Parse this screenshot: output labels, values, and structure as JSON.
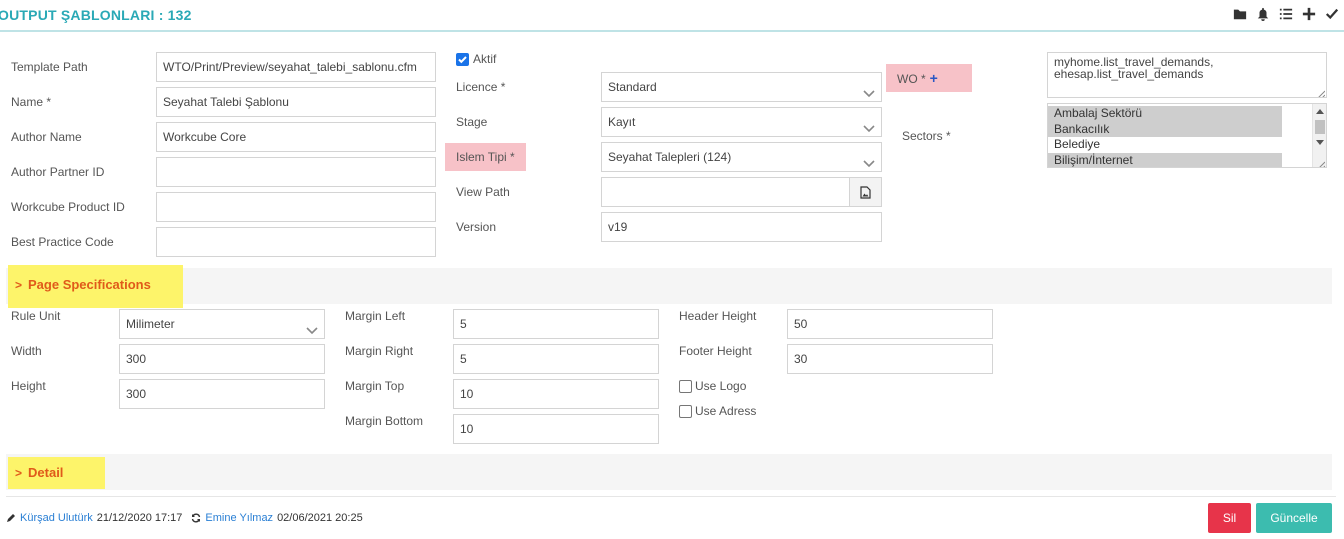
{
  "header": {
    "title": "OUTPUT ŞABLONLARI : 132",
    "icons": [
      "folder-icon",
      "bell-icon",
      "list-icon",
      "plus-icon",
      "check-icon"
    ]
  },
  "form": {
    "template_path": {
      "label": "Template Path",
      "value": "WTO/Print/Preview/seyahat_talebi_sablonu.cfm"
    },
    "name": {
      "label": "Name *",
      "value": "Seyahat Talebi Şablonu"
    },
    "author_name": {
      "label": "Author Name",
      "value": "Workcube Core"
    },
    "author_partner_id": {
      "label": "Author Partner ID",
      "value": ""
    },
    "workcube_product_id": {
      "label": "Workcube Product ID",
      "value": ""
    },
    "best_practice_code": {
      "label": "Best Practice Code",
      "value": ""
    },
    "aktif": {
      "label": "Aktif",
      "checked": true
    },
    "licence": {
      "label": "Licence *",
      "value": "Standard"
    },
    "stage": {
      "label": "Stage",
      "value": "Kayıt"
    },
    "islem_tipi": {
      "label": "Islem Tipi *",
      "value": "Seyahat Talepleri (124)"
    },
    "view_path": {
      "label": "View Path",
      "value": ""
    },
    "version": {
      "label": "Version",
      "value": "v19"
    },
    "wo": {
      "label": "WO *",
      "add": "+"
    },
    "wo_text": {
      "line1": "myhome.list_travel_demands,",
      "line2": "ehesap.list_travel_demands"
    },
    "sectors": {
      "label": "Sectors *",
      "options": [
        {
          "text": "Ambalaj Sektörü",
          "selected": true
        },
        {
          "text": "Bankacılık",
          "selected": true
        },
        {
          "text": "Belediye",
          "selected": false
        },
        {
          "text": "Bilişim/İnternet",
          "selected": true
        }
      ]
    }
  },
  "page_spec": {
    "title": "Page Specifications",
    "rule_unit": {
      "label": "Rule Unit",
      "value": "Milimeter"
    },
    "width": {
      "label": "Width",
      "value": "300"
    },
    "height": {
      "label": "Height",
      "value": "300"
    },
    "margin_left": {
      "label": "Margin Left",
      "value": "5"
    },
    "margin_right": {
      "label": "Margin Right",
      "value": "5"
    },
    "margin_top": {
      "label": "Margin Top",
      "value": "10"
    },
    "margin_bottom": {
      "label": "Margin Bottom",
      "value": "10"
    },
    "header_height": {
      "label": "Header Height",
      "value": "50"
    },
    "footer_height": {
      "label": "Footer Height",
      "value": "30"
    },
    "use_logo": {
      "label": "Use Logo",
      "checked": false
    },
    "use_adress": {
      "label": "Use Adress",
      "checked": false
    }
  },
  "detail": {
    "title": "Detail"
  },
  "footer": {
    "created_by": "Kürşad Ulutürk",
    "created_at": "21/12/2020 17:17",
    "updated_by": "Emine Yılmaz",
    "updated_at": "02/06/2021 20:25",
    "delete_label": "Sil",
    "update_label": "Güncelle"
  },
  "colors": {
    "accent": "#2aa9b6",
    "section_highlight": "#fdf46a",
    "required_highlight": "#f7c2c8",
    "delete": "#e7344a",
    "update": "#3cbcaf"
  }
}
